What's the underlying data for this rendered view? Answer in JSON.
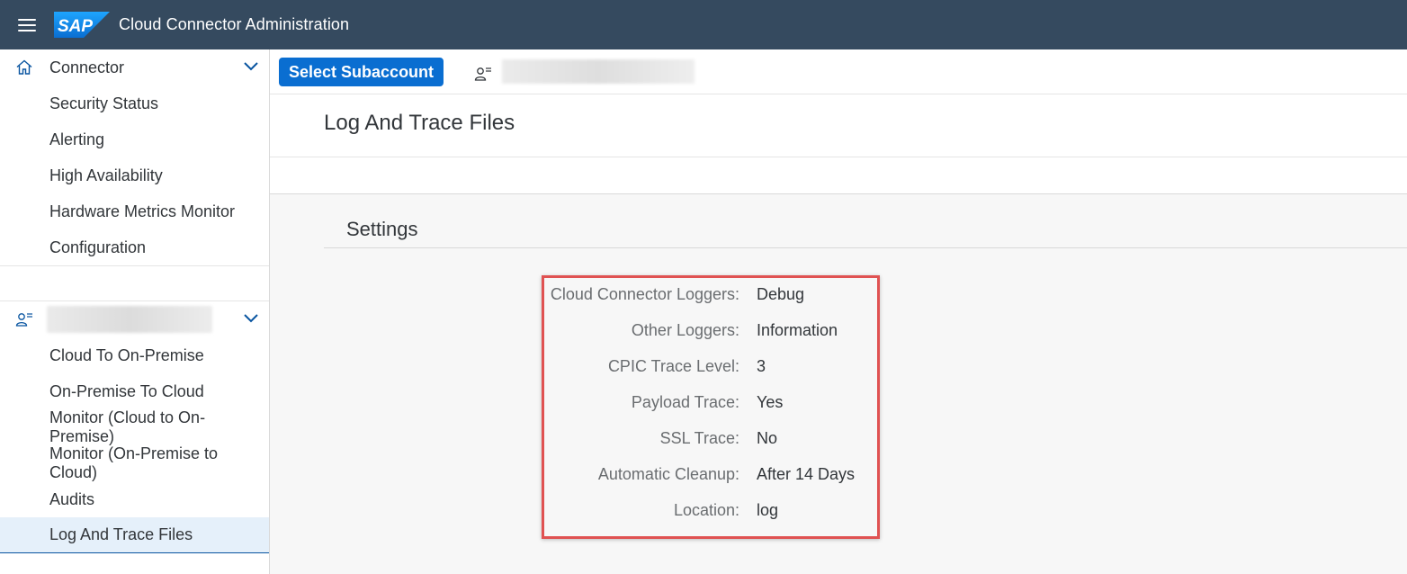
{
  "shell": {
    "logo_text": "SAP",
    "title": "Cloud Connector Administration"
  },
  "sidebar": {
    "connector_group": {
      "label": "Connector",
      "items": [
        {
          "label": "Security Status"
        },
        {
          "label": "Alerting"
        },
        {
          "label": "High Availability"
        },
        {
          "label": "Hardware Metrics Monitor"
        },
        {
          "label": "Configuration"
        }
      ]
    },
    "subaccount_group": {
      "items": [
        {
          "label": "Cloud To On-Premise"
        },
        {
          "label": "On-Premise To Cloud"
        },
        {
          "label": "Monitor (Cloud to On-Premise)"
        },
        {
          "label": "Monitor (On-Premise to Cloud)"
        },
        {
          "label": "Audits"
        },
        {
          "label": "Log And Trace Files",
          "selected": true
        }
      ]
    }
  },
  "toolbar": {
    "select_subaccount_label": "Select Subaccount"
  },
  "page": {
    "title": "Log And Trace Files",
    "section_title": "Settings"
  },
  "settings": [
    {
      "label": "Cloud Connector Loggers:",
      "value": "Debug"
    },
    {
      "label": "Other Loggers:",
      "value": "Information"
    },
    {
      "label": "CPIC Trace Level:",
      "value": "3"
    },
    {
      "label": "Payload Trace:",
      "value": "Yes"
    },
    {
      "label": "SSL Trace:",
      "value": "No"
    },
    {
      "label": "Automatic Cleanup:",
      "value": "After 14 Days"
    },
    {
      "label": "Location:",
      "value": "log"
    }
  ],
  "colors": {
    "shell_bg": "#354a5f",
    "brand_blue": "#0a6ed1",
    "highlight_border": "#e05252",
    "selected_bg": "#e5f0fa"
  }
}
